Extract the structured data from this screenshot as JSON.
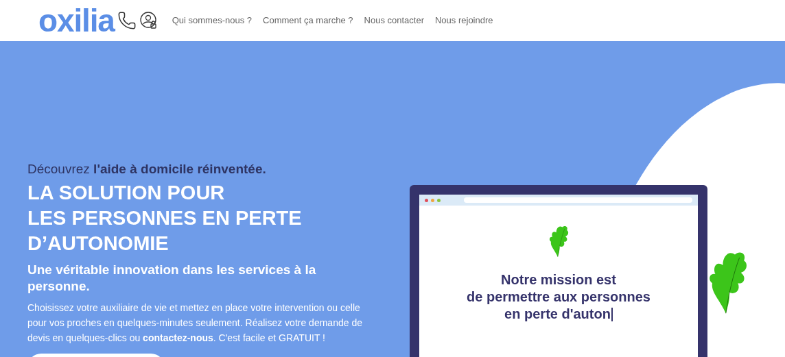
{
  "header": {
    "logo": "oxilia",
    "nav": [
      {
        "label": "Qui sommes-nous ?"
      },
      {
        "label": "Comment ça marche ?"
      },
      {
        "label": "Nous contacter"
      },
      {
        "label": "Nous rejoindre"
      }
    ]
  },
  "hero": {
    "intro": "Découvrez **l'aide à domicile réinventée.**",
    "headline": [
      "LA SOLUTION POUR",
      "LES PERSONNES EN PERTE",
      "D’AUTONOMIE"
    ],
    "subheadline": "Une véritable innovation dans les services à la personne.",
    "paragraph": "Choisissez votre auxiliaire de vie et mettez en place votre intervention ou celle pour vos proches en quelques-minutes seulement. Réalisez votre demande de devis en quelques-clics ou **contactez-nous**. C'est facile et GRATUIT !"
  },
  "mission": {
    "lines": [
      "Notre mission est",
      "de permettre aux personnes",
      "en perte d'auton"
    ]
  }
}
